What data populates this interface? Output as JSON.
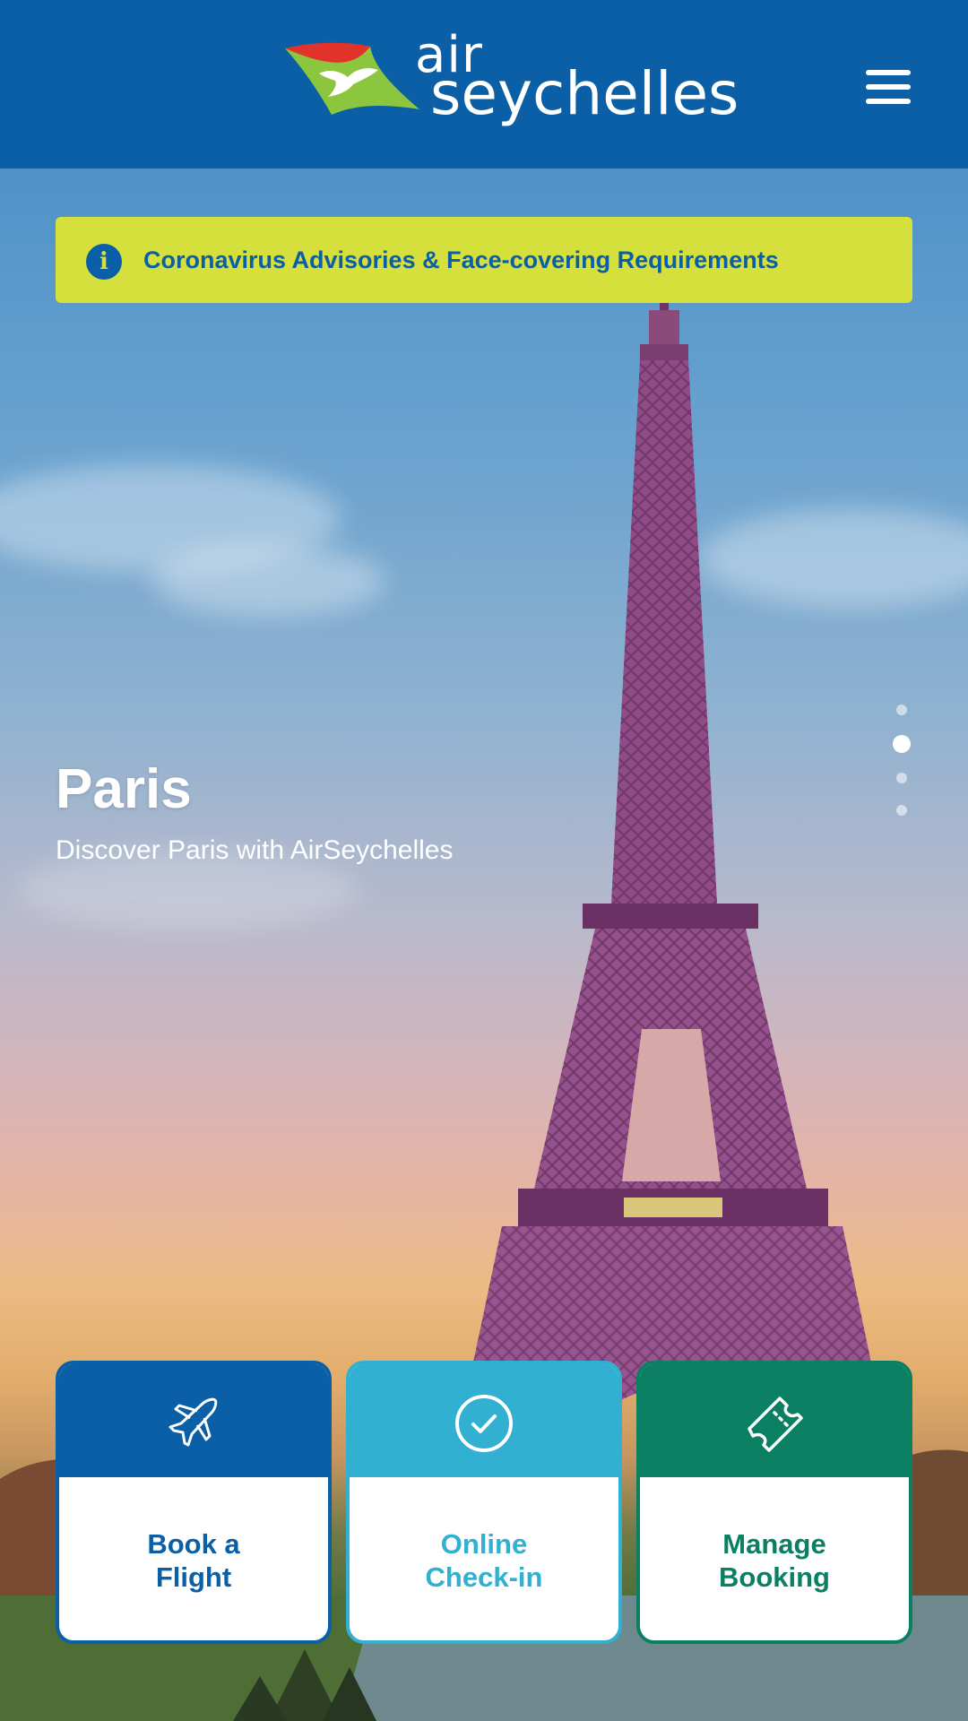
{
  "brand": {
    "logo_line1": "air",
    "logo_line2": "seychelles",
    "colors": {
      "primary": "#0a5fa6",
      "advisory": "#d5e03c",
      "checkin": "#31b0d2",
      "manage": "#0a7f62",
      "logo_red": "#e2332b",
      "logo_green": "#8cc63f"
    }
  },
  "header": {
    "menu_icon": "hamburger-menu-icon"
  },
  "advisory": {
    "icon": "info-icon",
    "icon_glyph": "i",
    "text": "Coronavirus Advisories & Face-covering Requirements"
  },
  "slide": {
    "title": "Paris",
    "subtitle": "Discover Paris with AirSeychelles",
    "pager": {
      "count": 4,
      "active_index": 1
    }
  },
  "actions": [
    {
      "label_line1": "Book a",
      "label_line2": "Flight",
      "icon": "airplane-icon",
      "color": "#0a5fa6"
    },
    {
      "label_line1": "Online",
      "label_line2": "Check-in",
      "icon": "check-circle-icon",
      "color": "#31b0d2"
    },
    {
      "label_line1": "Manage",
      "label_line2": "Booking",
      "icon": "ticket-icon",
      "color": "#0a7f62"
    }
  ]
}
